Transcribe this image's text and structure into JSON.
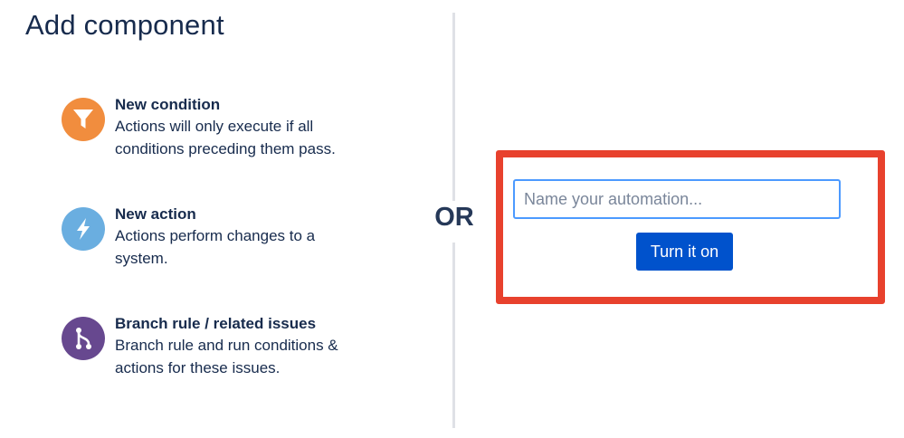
{
  "header": {
    "title": "Add component"
  },
  "components": [
    {
      "title": "New condition",
      "description_line1": "Actions will only execute if all",
      "description_line2": "conditions preceding them pass.",
      "icon": "filter-icon",
      "color": "#f18d3e"
    },
    {
      "title": "New action",
      "description_line1": "Actions perform changes to a",
      "description_line2": "system.",
      "icon": "lightning-icon",
      "color": "#6aaee0"
    },
    {
      "title": "Branch rule / related issues",
      "description_line1": "Branch rule and run conditions &",
      "description_line2": "actions for these issues.",
      "icon": "branch-icon",
      "color": "#67488f"
    }
  ],
  "separator": {
    "label": "OR"
  },
  "automation": {
    "name_value": "",
    "name_placeholder": "Name your automation...",
    "turn_on_label": "Turn it on",
    "highlight_color": "#e8412d",
    "button_color": "#0052cc"
  }
}
